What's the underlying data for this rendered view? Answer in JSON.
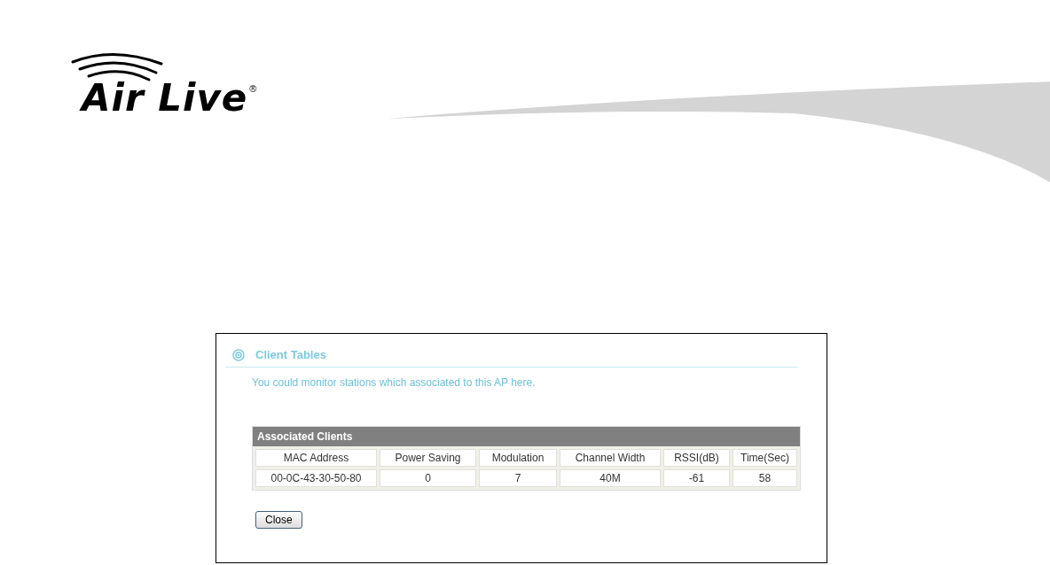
{
  "logo": {
    "text": "Air Live",
    "registered": "®"
  },
  "panel": {
    "title": "Client Tables",
    "description": "You could monitor stations which associated to this AP here.",
    "table": {
      "title": "Associated Clients",
      "columns": [
        "MAC Address",
        "Power Saving",
        "Modulation",
        "Channel Width",
        "RSSI(dB)",
        "Time(Sec)"
      ],
      "rows": [
        [
          "00-0C-43-30-50-80",
          "0",
          "7",
          "40M",
          "-61",
          "58"
        ]
      ]
    },
    "buttons": [
      "Close"
    ]
  }
}
